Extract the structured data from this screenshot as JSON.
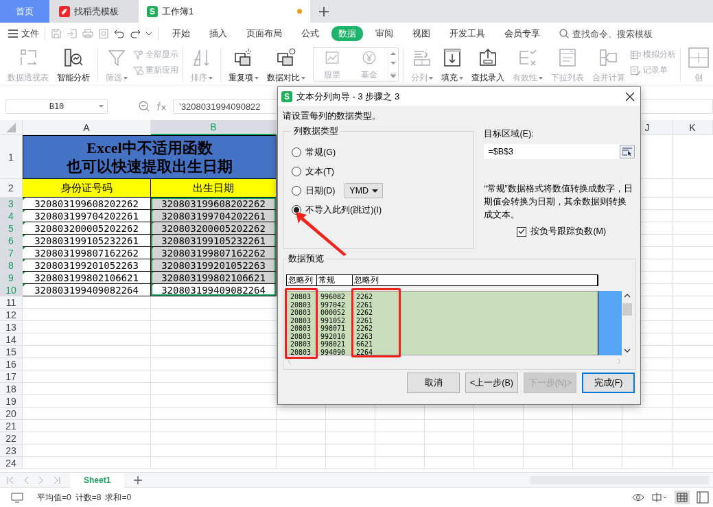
{
  "tabs": [
    {
      "label": "首页",
      "kind": "home",
      "selected": false
    },
    {
      "label": "找稻壳模板",
      "kind": "docer",
      "selected": false
    },
    {
      "label": "工作簿1",
      "kind": "sheet",
      "logo": "S",
      "selected": true,
      "unsaved": true
    }
  ],
  "menu": {
    "file": "文件",
    "tabs": [
      {
        "label": "开始",
        "selected": false
      },
      {
        "label": "插入",
        "selected": false
      },
      {
        "label": "页面布局",
        "selected": false
      },
      {
        "label": "公式",
        "selected": false
      },
      {
        "label": "数据",
        "selected": true
      },
      {
        "label": "审阅",
        "selected": false
      },
      {
        "label": "视图",
        "selected": false
      },
      {
        "label": "开发工具",
        "selected": false
      },
      {
        "label": "会员专享",
        "selected": false
      }
    ],
    "search": {
      "placeholder": "查找命令、搜索模板"
    }
  },
  "ribbon": {
    "groups": [
      {
        "items": [
          {
            "kind": "large",
            "label": "数据透视表",
            "disabled": true,
            "dropdown": false
          },
          {
            "kind": "large",
            "label": "智能分析",
            "disabled": false,
            "dropdown": false
          }
        ]
      },
      {
        "items": [
          {
            "kind": "large",
            "label": "筛选",
            "disabled": true,
            "dropdown": true
          },
          {
            "kind": "stack",
            "items": [
              {
                "label": "全部显示",
                "disabled": true
              },
              {
                "label": "重新应用",
                "disabled": true
              }
            ]
          }
        ]
      },
      {
        "items": [
          {
            "kind": "large",
            "label": "排序",
            "disabled": true,
            "dropdown": true
          }
        ]
      },
      {
        "items": [
          {
            "kind": "large",
            "label": "重复项",
            "disabled": false,
            "dropdown": true
          },
          {
            "kind": "large",
            "label": "数据对比",
            "disabled": false,
            "dropdown": true
          },
          {
            "kind": "gallery",
            "items": [
              {
                "label": "股票",
                "disabled": true
              },
              {
                "label": "基金",
                "disabled": true
              }
            ]
          }
        ]
      },
      {
        "items": [
          {
            "kind": "large",
            "label": "分列",
            "disabled": true,
            "dropdown": true
          },
          {
            "kind": "large",
            "label": "填充",
            "disabled": false,
            "dropdown": true
          },
          {
            "kind": "large",
            "label": "查找录入",
            "disabled": false,
            "dropdown": false
          },
          {
            "kind": "large",
            "label": "有效性",
            "disabled": true,
            "dropdown": true
          },
          {
            "kind": "large",
            "label": "下拉列表",
            "disabled": true,
            "dropdown": false
          },
          {
            "kind": "large",
            "label": "合并计算",
            "disabled": true,
            "dropdown": false
          },
          {
            "kind": "stack",
            "items": [
              {
                "label": "模拟分析",
                "disabled": true
              },
              {
                "label": "记录单",
                "disabled": true
              }
            ]
          }
        ]
      },
      {
        "items": [
          {
            "kind": "large",
            "label": "创",
            "disabled": true,
            "dropdown": false
          }
        ]
      }
    ]
  },
  "formula_bar": {
    "name_box": "B10",
    "formula": "’3208031994090822"
  },
  "sheet": {
    "columns": [
      {
        "label": "A",
        "selected": false
      },
      {
        "label": "B",
        "selected": true
      },
      {
        "label": "J",
        "selected": false
      },
      {
        "label": "K",
        "selected": false
      }
    ],
    "title_row": {
      "number": "1",
      "lines": [
        "Excel中不适用函数",
        "也可以快速提取出生日期"
      ]
    },
    "header_row": {
      "number": "2",
      "cells": [
        "身份证号码",
        "出生日期"
      ]
    },
    "rows": [
      {
        "number": "3",
        "id": "320803199608202262",
        "birth": "320803199608202262",
        "selected": true,
        "active": false
      },
      {
        "number": "4",
        "id": "320803199704202261",
        "birth": "320803199704202261",
        "selected": true,
        "active": false
      },
      {
        "number": "5",
        "id": "320803200005202262",
        "birth": "320803200005202262",
        "selected": true,
        "active": false
      },
      {
        "number": "6",
        "id": "320803199105232261",
        "birth": "320803199105232261",
        "selected": true,
        "active": false
      },
      {
        "number": "7",
        "id": "320803199807162262",
        "birth": "320803199807162262",
        "selected": true,
        "active": false
      },
      {
        "number": "8",
        "id": "320803199201052263",
        "birth": "320803199201052263",
        "selected": true,
        "active": false
      },
      {
        "number": "9",
        "id": "320803199802106621",
        "birth": "320803199802106621",
        "selected": true,
        "active": false
      },
      {
        "number": "10",
        "id": "320803199409082264",
        "birth": "320803199409082264",
        "selected": true,
        "active": true
      }
    ],
    "empty_rows": [
      {
        "number": "11",
        "selected": false
      },
      {
        "number": "12",
        "selected": false
      },
      {
        "number": "13",
        "selected": false
      },
      {
        "number": "14",
        "selected": false
      },
      {
        "number": "15",
        "selected": false
      },
      {
        "number": "16",
        "selected": false
      },
      {
        "number": "17",
        "selected": false
      },
      {
        "number": "18",
        "selected": false
      },
      {
        "number": "19",
        "selected": false
      },
      {
        "number": "20",
        "selected": false
      },
      {
        "number": "21",
        "selected": false
      },
      {
        "number": "22",
        "selected": false
      },
      {
        "number": "23",
        "selected": false
      },
      {
        "number": "24",
        "selected": false
      }
    ]
  },
  "dialog": {
    "logo": "S",
    "title": "文本分列向导 - 3 步骤之 3",
    "instruction": "请设置每列的数据类型。",
    "column_type": {
      "legend": "列数据类型",
      "options": [
        {
          "label": "常规(G)",
          "selected": false
        },
        {
          "label": "文本(T)",
          "selected": false
        },
        {
          "label": "日期(D)",
          "selected": false,
          "format": "YMD"
        },
        {
          "label": "不导入此列(跳过)(I)",
          "selected": true
        }
      ]
    },
    "destination": {
      "label": "目标区域(E):",
      "value": "=$B$3"
    },
    "note": "“常规”数据格式将数值转换成数字，日期值会转换为日期，其余数据则转换成文本。",
    "negative_checkbox": {
      "label": "按负号跟踪负数(M)",
      "checked": true
    },
    "preview": {
      "legend": "数据预览",
      "headers": [
        "忽略列",
        "常规",
        "忽略列"
      ],
      "rows": [
        [
          "20803",
          "996082",
          "2262"
        ],
        [
          "20803",
          "997042",
          "2261"
        ],
        [
          "20803",
          "000052",
          "2262"
        ],
        [
          "20803",
          "991052",
          "2261"
        ],
        [
          "20803",
          "998071",
          "2262"
        ],
        [
          "20803",
          "992010",
          "2263"
        ],
        [
          "20803",
          "998021",
          "6621"
        ],
        [
          "20803",
          "994090",
          "2264"
        ]
      ]
    },
    "buttons": [
      {
        "label": "取消",
        "disabled": false,
        "default": false
      },
      {
        "label": "<上一步(B)",
        "disabled": false,
        "default": false
      },
      {
        "label": "下一步(N)>",
        "disabled": true,
        "default": false
      },
      {
        "label": "完成(F)",
        "disabled": false,
        "default": true
      }
    ]
  },
  "sheet_tabs": [
    {
      "label": "Sheet1",
      "selected": true
    }
  ],
  "status_bar": {
    "stats": [
      "平均值=0",
      "计数=8",
      "求和=0"
    ]
  }
}
